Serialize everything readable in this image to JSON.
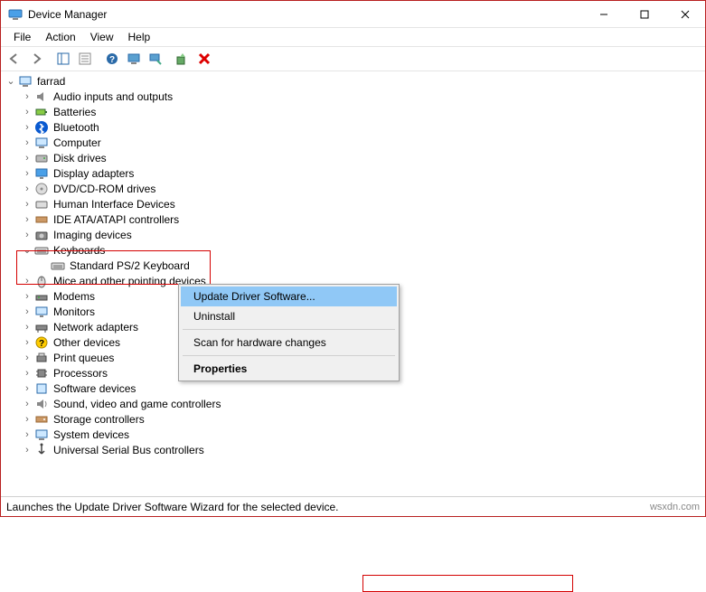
{
  "window": {
    "title": "Device Manager"
  },
  "menus": {
    "file": "File",
    "action": "Action",
    "view": "View",
    "help": "Help"
  },
  "root": "farrad",
  "items": {
    "audio": "Audio inputs and outputs",
    "batteries": "Batteries",
    "bluetooth": "Bluetooth",
    "computer": "Computer",
    "disk": "Disk drives",
    "display": "Display adapters",
    "dvd": "DVD/CD-ROM drives",
    "hid": "Human Interface Devices",
    "ide": "IDE ATA/ATAPI controllers",
    "imaging": "Imaging devices",
    "keyboards": "Keyboards",
    "kb_ps2": "Standard PS/2 Keyboard",
    "mice": "Mice and other pointing devices",
    "modems": "Modems",
    "monitors": "Monitors",
    "network": "Network adapters",
    "other": "Other devices",
    "printq": "Print queues",
    "processors": "Processors",
    "software": "Software devices",
    "sound": "Sound, video and game controllers",
    "storage": "Storage controllers",
    "system": "System devices",
    "usb": "Universal Serial Bus controllers"
  },
  "context": {
    "update": "Update Driver Software...",
    "uninstall": "Uninstall",
    "scan": "Scan for hardware changes",
    "properties": "Properties"
  },
  "status": "Launches the Update Driver Software Wizard for the selected device.",
  "watermark": "wsxdn.com"
}
